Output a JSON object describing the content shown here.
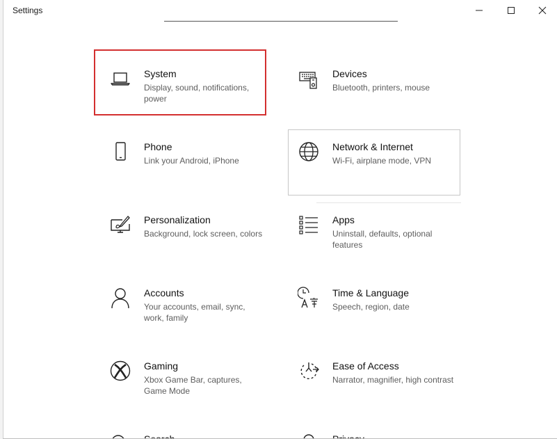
{
  "window": {
    "title": "Settings",
    "minimize_icon": "minimize-icon",
    "maximize_icon": "maximize-icon",
    "close_icon": "close-icon"
  },
  "tiles": [
    {
      "name": "System",
      "description": "Display, sound, notifications, power",
      "icon": "laptop-icon",
      "selected": true
    },
    {
      "name": "Devices",
      "description": "Bluetooth, printers, mouse",
      "icon": "devices-icon"
    },
    {
      "name": "Phone",
      "description": "Link your Android, iPhone",
      "icon": "phone-icon"
    },
    {
      "name": "Network & Internet",
      "description": "Wi-Fi, airplane mode, VPN",
      "icon": "globe-icon",
      "hovered": true
    },
    {
      "name": "Personalization",
      "description": "Background, lock screen, colors",
      "icon": "personalization-icon"
    },
    {
      "name": "Apps",
      "description": "Uninstall, defaults, optional features",
      "icon": "apps-list-icon"
    },
    {
      "name": "Accounts",
      "description": "Your accounts, email, sync, work, family",
      "icon": "person-icon"
    },
    {
      "name": "Time & Language",
      "description": "Speech, region, date",
      "icon": "time-language-icon"
    },
    {
      "name": "Gaming",
      "description": "Xbox Game Bar, captures, Game Mode",
      "icon": "xbox-icon"
    },
    {
      "name": "Ease of Access",
      "description": "Narrator, magnifier, high contrast",
      "icon": "ease-of-access-icon"
    },
    {
      "name": "Search",
      "description": "",
      "icon": "search-icon"
    },
    {
      "name": "Privacy",
      "description": "",
      "icon": "lock-icon"
    }
  ],
  "colors": {
    "selection_border": "#d32f2f",
    "hover_border": "#c6c6c6",
    "description_text": "#5d5d5d"
  }
}
